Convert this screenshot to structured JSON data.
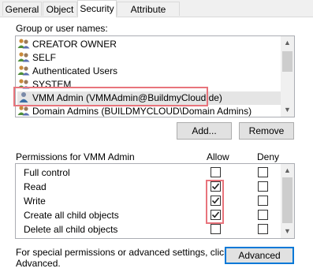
{
  "tabs": [
    {
      "label": "General",
      "active": false
    },
    {
      "label": "Object",
      "active": false
    },
    {
      "label": "Security",
      "active": true
    },
    {
      "label": "Attribute Editor",
      "active": false
    }
  ],
  "group_label": "Group or user names:",
  "users": [
    {
      "name": "CREATOR OWNER",
      "icon": "group-icon",
      "selected": false
    },
    {
      "name": "SELF",
      "icon": "group-icon",
      "selected": false
    },
    {
      "name": "Authenticated Users",
      "icon": "group-icon",
      "selected": false
    },
    {
      "name": "SYSTEM",
      "icon": "group-icon",
      "selected": false
    },
    {
      "name": "VMM Admin (VMMAdmin@BuildmyCloud.de)",
      "icon": "user-icon",
      "selected": true
    },
    {
      "name": "Domain Admins (BUILDMYCLOUD\\Domain Admins)",
      "icon": "group-icon",
      "selected": false
    }
  ],
  "add_button": "Add...",
  "remove_button": "Remove",
  "permissions_label": "Permissions for VMM Admin",
  "allow_header": "Allow",
  "deny_header": "Deny",
  "permissions": [
    {
      "name": "Full control",
      "allow": false,
      "deny": false
    },
    {
      "name": "Read",
      "allow": true,
      "deny": false
    },
    {
      "name": "Write",
      "allow": true,
      "deny": false
    },
    {
      "name": "Create all child objects",
      "allow": true,
      "deny": false
    },
    {
      "name": "Delete all child objects",
      "allow": false,
      "deny": false
    }
  ],
  "special_text_line1": "For special permissions or advanced settings, click",
  "special_text_line2": "Advanced.",
  "advanced_button": "Advanced",
  "colors": {
    "highlight": "#e8747c",
    "selected_row": "#e5e5e5",
    "accent": "#0078d7"
  }
}
